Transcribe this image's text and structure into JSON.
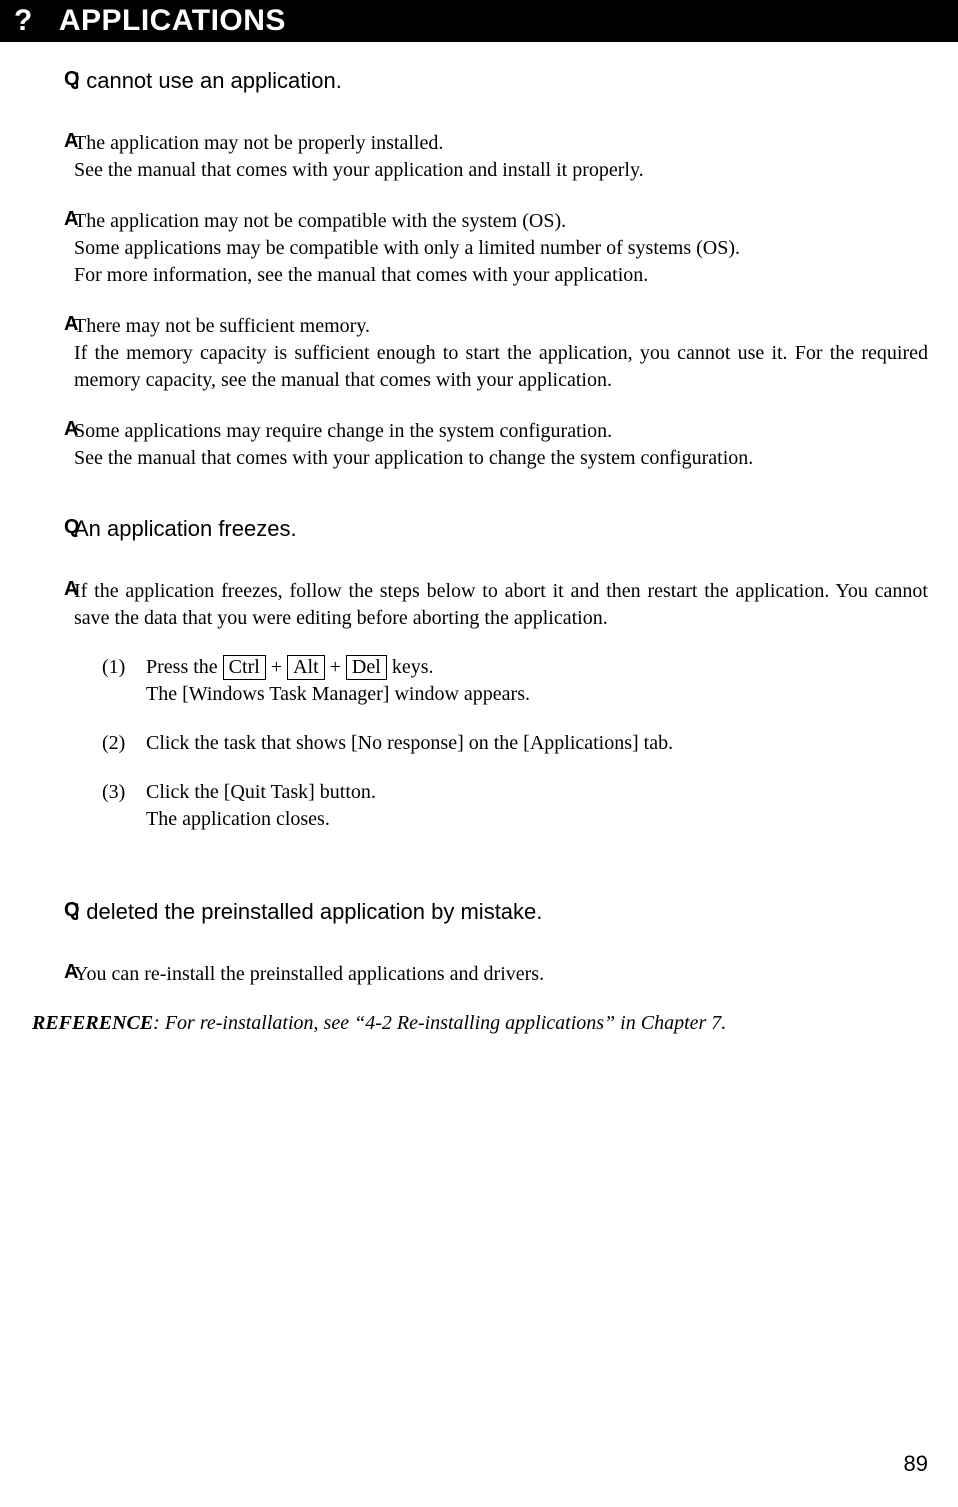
{
  "header": {
    "q_mark": "?",
    "title": "APPLICATIONS"
  },
  "q1": {
    "marker": "Q",
    "text": "I cannot use an application."
  },
  "a1_1": {
    "marker": "A",
    "text": "The application may not be properly installed.\nSee the manual that comes with your application and install it properly."
  },
  "a1_2": {
    "marker": "A",
    "text": "The application may not be compatible with the system (OS).\nSome applications may be compatible with only a limited number of systems (OS).\nFor more information, see the manual that comes with your application."
  },
  "a1_3": {
    "marker": "A",
    "text": "There may not be sufficient memory.\nIf the memory capacity is sufficient enough to start the application, you cannot use it. For the required memory capacity, see the manual that comes with your application."
  },
  "a1_4": {
    "marker": "A",
    "text": "Some applications may require change in the system configuration.\nSee the manual that comes with your application to change the system configuration."
  },
  "q2": {
    "marker": "Q",
    "text": "An application freezes."
  },
  "a2_1": {
    "marker": "A",
    "text": "If the application freezes, follow the steps below to abort it and then restart the application. You cannot save the data that you were editing before aborting the application."
  },
  "steps": {
    "s1": {
      "num": "(1)",
      "pre": "Press the ",
      "k1": "Ctrl",
      "plus1": " + ",
      "k2": "Alt",
      "plus2": " + ",
      "k3": "Del",
      "post": " keys.",
      "line2": "The [Windows Task Manager] window appears."
    },
    "s2": {
      "num": "(2)",
      "text": "Click the task that shows [No response] on the [Applications] tab."
    },
    "s3": {
      "num": "(3)",
      "text": "Click the [Quit Task] button.",
      "line2": "The application closes."
    }
  },
  "q3": {
    "marker": "Q",
    "text": "I deleted the preinstalled application by mistake."
  },
  "a3_1": {
    "marker": "A",
    "text": "You can re-install the preinstalled applications and drivers."
  },
  "reference": {
    "label": "REFERENCE",
    "text": ":  For re-installation, see “4-2 Re-installing applications” in Chapter 7."
  },
  "page_num": "89"
}
